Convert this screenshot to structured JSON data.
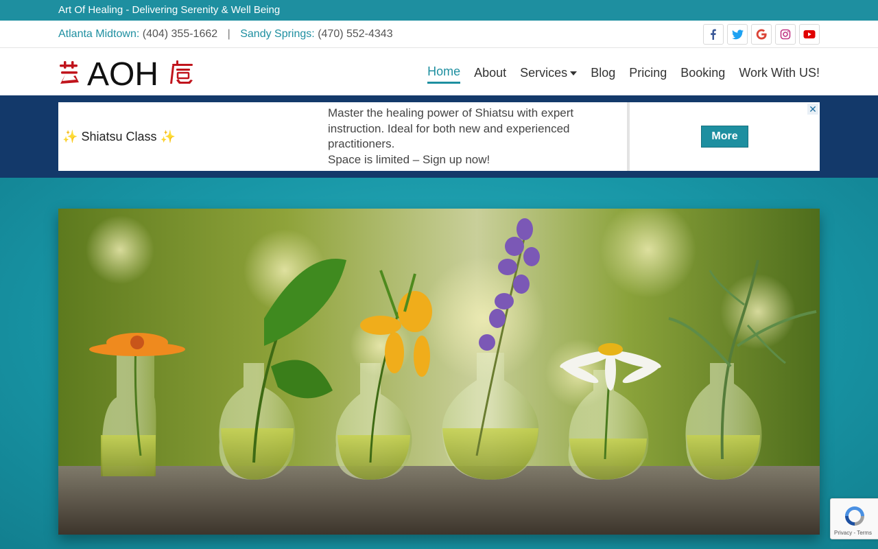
{
  "site": {
    "tagline": "Art Of Healing - Delivering Serenity & Well Being",
    "logo_text": "AOH"
  },
  "contacts": [
    {
      "location": "Atlanta Midtown:",
      "phone": "(404) 355-1662"
    },
    {
      "location": "Sandy Springs:",
      "phone": "(470) 552-4343"
    }
  ],
  "contact_separator": "|",
  "socials": [
    {
      "name": "facebook-icon",
      "color": "#3b5998"
    },
    {
      "name": "twitter-icon",
      "color": "#1da1f2"
    },
    {
      "name": "google-icon",
      "color": "#db4437"
    },
    {
      "name": "instagram-icon",
      "color": "#c13584"
    },
    {
      "name": "youtube-icon",
      "color": "#e00000"
    }
  ],
  "nav": {
    "items": [
      {
        "label": "Home",
        "active": true
      },
      {
        "label": "About"
      },
      {
        "label": "Services",
        "dropdown": true
      },
      {
        "label": "Blog"
      },
      {
        "label": "Pricing"
      },
      {
        "label": "Booking"
      },
      {
        "label": "Work With US!"
      }
    ]
  },
  "promo": {
    "sparkle": "✨",
    "title": "Shiatsu Class",
    "description": "Master the healing power of Shiatsu with expert instruction. Ideal for both new and experienced practitioners.",
    "cta_line": "Space is limited – Sign up now!",
    "button": "More",
    "close": "✕"
  },
  "recaptcha": {
    "links": "Privacy - Terms"
  },
  "colors": {
    "accent": "#1e8fa0",
    "banner": "#13396a",
    "logo_red": "#c0141c"
  }
}
